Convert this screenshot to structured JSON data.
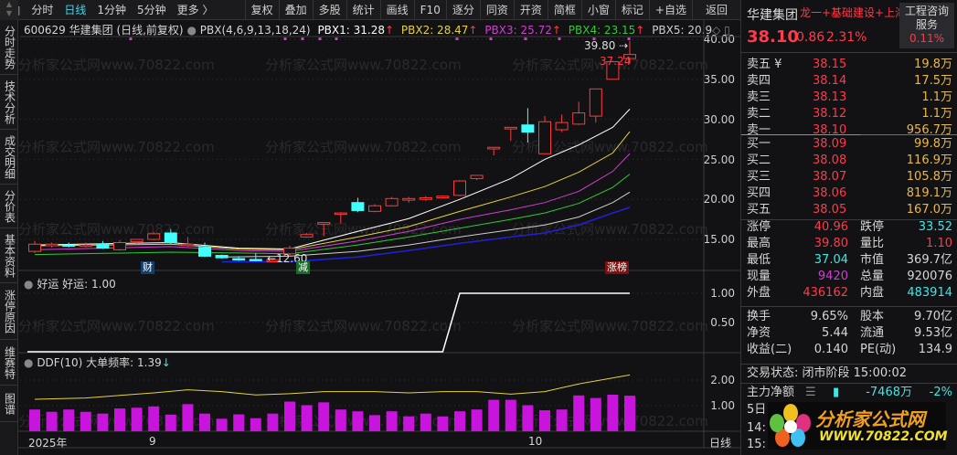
{
  "toolbar": {
    "tabs": [
      "分时",
      "日线",
      "1分钟",
      "5分钟",
      "更多 〉"
    ],
    "active_tab": "日线",
    "buttons": [
      "复权",
      "叠加",
      "多股",
      "统计",
      "画线",
      "F10",
      "逐分",
      "同资",
      "开资",
      "简框",
      "小窗",
      "标记",
      "+自选",
      "返回"
    ]
  },
  "side_tabs": [
    "分时走势",
    "技术分析",
    "成交明细",
    "分价表",
    "基本资料",
    "涨停原因",
    "维赛特",
    "图谱"
  ],
  "main_header": {
    "title": "600629 华建集团 (日线,前复权)",
    "indicator": "PBX(4,6,9,13,18,24)",
    "pbx": [
      {
        "label": "PBX1: 31.28",
        "arrow": "↑",
        "color": "#ffffff"
      },
      {
        "label": "PBX2: 28.47",
        "arrow": "↑",
        "color": "#e6d23a"
      },
      {
        "label": "PBX3: 25.72",
        "arrow": "↑",
        "color": "#d23cd2"
      },
      {
        "label": "PBX4: 23.15",
        "arrow": "↑",
        "color": "#32c832"
      },
      {
        "label": "PBX5: 20.9",
        "arrow": "◇",
        "color": "#cfcfcf"
      }
    ]
  },
  "panel2_header": {
    "name": "好运",
    "value": "好运: 1.00"
  },
  "panel3_header": {
    "name": "DDF(10)",
    "value": "大单频率: 1.39",
    "arrow": "↓"
  },
  "annotations": {
    "high": "39.80",
    "low_recent": "37.24",
    "low": "12.60",
    "tag_cai": "财",
    "tag_jian": "减",
    "tag_zhangbang": "涨榜"
  },
  "dates": {
    "start": "2025年",
    "sep": "9",
    "oct": "10",
    "period": "日线"
  },
  "watermark": "分析家公式网www.70822.com",
  "chart_data": [
    {
      "type": "candlestick",
      "title": "PBX(4,6,9,13,18,24)",
      "yticks": [
        "40.00",
        "35.00",
        "30.00",
        "25.00",
        "20.00",
        "15.00"
      ],
      "ylim": [
        13,
        40
      ],
      "ohlc": [
        [
          13.5,
          14.8,
          13.3,
          14.4
        ],
        [
          14.2,
          14.6,
          14.0,
          14.4
        ],
        [
          14.3,
          14.6,
          14.0,
          14.2
        ],
        [
          14.2,
          14.6,
          14.0,
          14.3
        ],
        [
          14.4,
          14.8,
          13.8,
          13.9
        ],
        [
          13.7,
          14.9,
          13.6,
          14.6
        ],
        [
          14.7,
          15.0,
          14.5,
          15.0
        ],
        [
          15.0,
          15.9,
          14.9,
          15.7
        ],
        [
          15.8,
          16.3,
          14.4,
          14.6
        ],
        [
          14.3,
          15.3,
          14.1,
          14.4
        ],
        [
          14.0,
          14.6,
          12.8,
          12.9
        ],
        [
          13.0,
          13.1,
          12.6,
          12.7
        ],
        [
          12.6,
          12.9,
          12.3,
          12.5
        ],
        [
          12.5,
          13.3,
          12.3,
          12.4
        ],
        [
          12.2,
          12.5,
          12.6,
          12.4
        ],
        [
          13.2,
          14.2,
          12.9,
          13.9
        ],
        [
          15.3,
          15.8,
          15.2,
          15.6
        ],
        [
          16.9,
          17.0,
          15.4,
          17.1
        ],
        [
          18.2,
          18.4,
          17.0,
          18.3
        ],
        [
          19.6,
          20.2,
          18.4,
          18.6
        ],
        [
          18.5,
          19.4,
          18.4,
          19.2
        ],
        [
          19.2,
          20.3,
          19.1,
          20.1
        ],
        [
          19.9,
          20.3,
          19.6,
          20.1
        ],
        [
          20.0,
          20.4,
          19.8,
          20.2
        ],
        [
          20.2,
          20.5,
          20.1,
          20.4
        ],
        [
          20.5,
          22.4,
          20.4,
          22.3
        ],
        [
          22.6,
          22.9,
          22.4,
          23.0
        ],
        [
          26.3,
          26.4,
          25.5,
          26.5
        ],
        [
          28.8,
          28.9,
          27.3,
          29.0
        ],
        [
          29.3,
          31.4,
          27.1,
          28.4
        ],
        [
          25.7,
          30.4,
          25.7,
          29.7
        ],
        [
          28.7,
          30.6,
          28.4,
          29.6
        ],
        [
          29.4,
          32.2,
          29.3,
          30.8
        ],
        [
          30.4,
          33.8,
          29.6,
          33.8
        ],
        [
          35.0,
          37.3,
          35.0,
          37.2
        ],
        [
          37.6,
          39.8,
          37.0,
          38.1
        ]
      ],
      "series": [
        {
          "name": "PBX1",
          "color": "#ffffff",
          "points": [
            [
              0,
              14.3
            ],
            [
              8,
              14.6
            ],
            [
              12,
              13.9
            ],
            [
              15,
              13.8
            ],
            [
              19,
              16.0
            ],
            [
              22,
              17.6
            ],
            [
              25,
              20.0
            ],
            [
              28,
              22.6
            ],
            [
              30,
              25.0
            ],
            [
              32,
              26.8
            ],
            [
              34,
              29.0
            ],
            [
              35,
              31.28
            ]
          ]
        },
        {
          "name": "PBX2",
          "color": "#e6d23a",
          "points": [
            [
              0,
              14.2
            ],
            [
              8,
              14.4
            ],
            [
              12,
              13.8
            ],
            [
              15,
              13.7
            ],
            [
              19,
              15.3
            ],
            [
              22,
              16.6
            ],
            [
              25,
              18.5
            ],
            [
              28,
              20.3
            ],
            [
              30,
              21.6
            ],
            [
              32,
              23.4
            ],
            [
              34,
              25.8
            ],
            [
              35,
              28.47
            ]
          ]
        },
        {
          "name": "PBX3",
          "color": "#d23cd2",
          "points": [
            [
              0,
              13.7
            ],
            [
              8,
              14.1
            ],
            [
              12,
              13.6
            ],
            [
              15,
              13.5
            ],
            [
              19,
              14.8
            ],
            [
              22,
              16.0
            ],
            [
              25,
              17.5
            ],
            [
              28,
              18.7
            ],
            [
              30,
              19.6
            ],
            [
              32,
              21.0
            ],
            [
              34,
              23.5
            ],
            [
              35,
              25.72
            ]
          ]
        },
        {
          "name": "PBX4",
          "color": "#32c832",
          "points": [
            [
              0,
              13.1
            ],
            [
              8,
              13.4
            ],
            [
              12,
              13.3
            ],
            [
              15,
              13.2
            ],
            [
              19,
              14.3
            ],
            [
              22,
              15.3
            ],
            [
              25,
              16.4
            ],
            [
              28,
              17.5
            ],
            [
              30,
              18.3
            ],
            [
              32,
              19.5
            ],
            [
              34,
              21.5
            ],
            [
              35,
              23.15
            ]
          ]
        },
        {
          "name": "PBX5",
          "color": "#cfcfcf",
          "points": [
            [
              11,
              12.8
            ],
            [
              15,
              12.9
            ],
            [
              19,
              13.5
            ],
            [
              22,
              14.3
            ],
            [
              25,
              15.3
            ],
            [
              28,
              16.2
            ],
            [
              30,
              16.8
            ],
            [
              32,
              17.8
            ],
            [
              34,
              19.6
            ],
            [
              35,
              20.9
            ]
          ]
        },
        {
          "name": "PBX6",
          "color": "#2020d8",
          "points": [
            [
              11,
              12.2
            ],
            [
              15,
              12.2
            ],
            [
              19,
              12.8
            ],
            [
              22,
              13.6
            ],
            [
              25,
              14.5
            ],
            [
              28,
              15.3
            ],
            [
              30,
              15.8
            ],
            [
              32,
              16.8
            ],
            [
              34,
              18.3
            ],
            [
              35,
              19.0
            ]
          ]
        }
      ]
    },
    {
      "type": "line",
      "title": "好运",
      "yticks": [
        "1.00",
        "0.50"
      ],
      "ylim": [
        0,
        1
      ],
      "values": [
        0,
        0,
        0,
        0,
        0,
        0,
        0,
        0,
        0,
        0,
        0,
        0,
        0,
        0,
        0,
        0,
        0,
        0,
        0,
        0,
        0,
        0,
        0,
        0,
        0,
        1,
        1,
        1,
        1,
        1,
        1,
        1,
        1,
        1,
        1,
        1
      ]
    },
    {
      "type": "bar",
      "title": "DDF(10)",
      "yticks": [
        "2.00",
        "1.00"
      ],
      "ylim": [
        0,
        2.2
      ],
      "values": [
        0.85,
        0.76,
        0.85,
        0.76,
        0.69,
        0.89,
        0.92,
        0.97,
        0.65,
        1.06,
        0.69,
        0.49,
        0.66,
        0.51,
        0.69,
        1.16,
        1.02,
        1.13,
        0.85,
        0.78,
        0.63,
        0.78,
        0.58,
        0.69,
        0.58,
        0.78,
        0.85,
        1.23,
        1.23,
        1.02,
        0.82,
        0.85,
        1.4,
        1.3,
        1.43,
        1.39
      ],
      "line": [
        [
          0,
          1.25
        ],
        [
          3,
          1.3
        ],
        [
          5,
          1.4
        ],
        [
          7,
          1.5
        ],
        [
          9,
          1.62
        ],
        [
          11,
          1.55
        ],
        [
          13,
          1.42
        ],
        [
          15,
          1.47
        ],
        [
          17,
          1.55
        ],
        [
          20,
          1.55
        ],
        [
          22,
          1.5
        ],
        [
          24,
          1.55
        ],
        [
          26,
          1.55
        ],
        [
          28,
          1.45
        ],
        [
          30,
          1.55
        ],
        [
          31,
          1.7
        ],
        [
          32,
          1.85
        ],
        [
          35,
          2.2
        ]
      ],
      "line_color": "#e6d23a",
      "bar_color": "#c814dc"
    }
  ],
  "quote": {
    "name": "华建集团",
    "concepts": "龙一+基础建设+上海国",
    "industry": "工程咨询服务",
    "industry_pct": "0.11%",
    "price": "38.10",
    "change": "0.86",
    "pct": "2.31%",
    "asks": [
      {
        "label": "卖五 ¥",
        "price": "38.15",
        "vol": "19.8万"
      },
      {
        "label": "卖四",
        "price": "38.14",
        "vol": "17.5万"
      },
      {
        "label": "卖三",
        "price": "38.13",
        "vol": "1.1万"
      },
      {
        "label": "卖二",
        "price": "38.12",
        "vol": "1.1万"
      },
      {
        "label": "卖一",
        "price": "38.10",
        "vol": "956.7万"
      }
    ],
    "bids": [
      {
        "label": "买一",
        "price": "38.09",
        "vol": "99.8万"
      },
      {
        "label": "买二",
        "price": "38.08",
        "vol": "116.9万"
      },
      {
        "label": "买三",
        "price": "38.07",
        "vol": "105.8万"
      },
      {
        "label": "买四",
        "price": "38.06",
        "vol": "819.1万"
      },
      {
        "label": "买五",
        "price": "38.05",
        "vol": "167.0万"
      }
    ],
    "stats": [
      [
        {
          "l": "涨停",
          "v": "40.96",
          "c": "red"
        },
        {
          "l": "跌停",
          "v": "33.52",
          "c": "cyan"
        }
      ],
      [
        {
          "l": "最高",
          "v": "39.80",
          "c": "red"
        },
        {
          "l": "量比",
          "v": "1.10",
          "c": "red"
        }
      ],
      [
        {
          "l": "最低",
          "v": "37.04",
          "c": "cyan"
        },
        {
          "l": "市值",
          "v": "369.7亿",
          "c": "wh"
        }
      ],
      [
        {
          "l": "现量",
          "v": "9420",
          "c": "mag"
        },
        {
          "l": "总量",
          "v": "920076",
          "c": "wh"
        }
      ],
      [
        {
          "l": "外盘",
          "v": "436162",
          "c": "red"
        },
        {
          "l": "内盘",
          "v": "483914",
          "c": "cyan"
        }
      ]
    ],
    "fundamentals": [
      [
        {
          "l": "换手",
          "v": "9.65%"
        },
        {
          "l": "股本",
          "v": "9.70亿"
        }
      ],
      [
        {
          "l": "净资",
          "v": "5.44"
        },
        {
          "l": "流通",
          "v": "9.53亿"
        }
      ],
      [
        {
          "l": "收益(二)",
          "v": "0.140"
        },
        {
          "l": "PE(动)",
          "v": "134.9"
        }
      ]
    ],
    "trade_status": "交易状态: 闭市阶段 15:00:02",
    "main_net_label": "主力净额",
    "main_net": "-7468万",
    "main_net_pct": "-2%",
    "five_day": "5日",
    "t1": "14:",
    "t2": "15:"
  },
  "logo": {
    "title": "分析家公式网",
    "url": "WWW.70822.COM"
  }
}
